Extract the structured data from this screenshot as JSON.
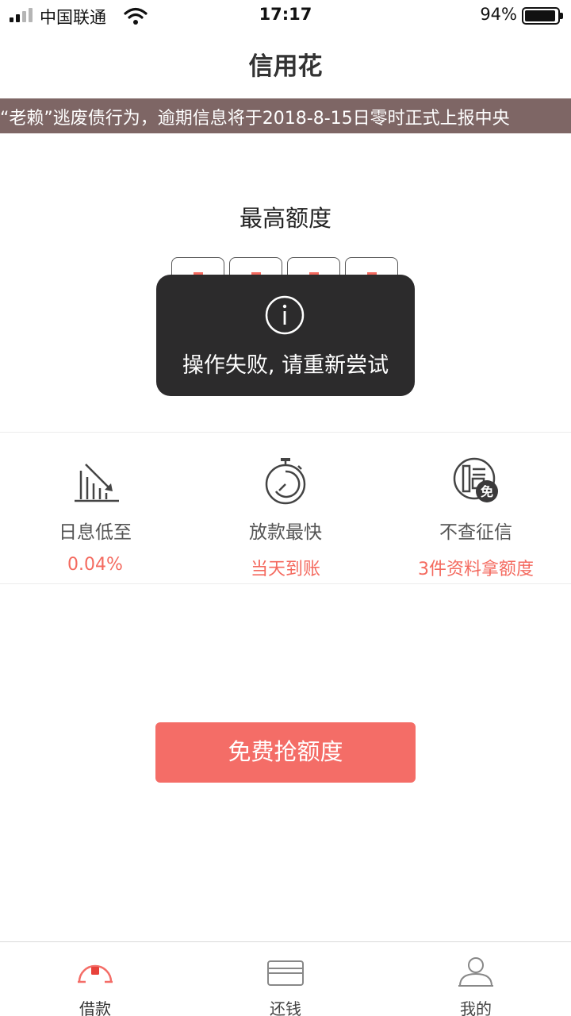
{
  "status_bar": {
    "carrier": "中国联通",
    "time": "17:17",
    "battery": "94%",
    "battery_level": 0.94
  },
  "nav": {
    "title": "信用花"
  },
  "notice": {
    "text": "“老赖”逃废债行为，逾期信息将于2018-8-15日零时正式上报中央"
  },
  "quota": {
    "title": "最高额度"
  },
  "toast": {
    "icon": "info-icon",
    "message": "操作失败, 请重新尝试"
  },
  "features": [
    {
      "icon": "declining-chart-icon",
      "label": "日息低至",
      "value": "0.04%"
    },
    {
      "icon": "stopwatch-icon",
      "label": "放款最快",
      "value": "当天到账"
    },
    {
      "icon": "no-credit-check-icon",
      "label": "不查征信",
      "value": "3件资料拿额度"
    }
  ],
  "cta": {
    "label": "免费抢额度"
  },
  "tabs": [
    {
      "icon": "loan-icon",
      "label": "借款",
      "active": true
    },
    {
      "icon": "card-icon",
      "label": "还钱",
      "active": false
    },
    {
      "icon": "user-icon",
      "label": "我的",
      "active": false
    }
  ],
  "colors": {
    "accent": "#f46d67",
    "notice_bg": "#7e6665",
    "toast_bg": "#2c2b2c"
  }
}
